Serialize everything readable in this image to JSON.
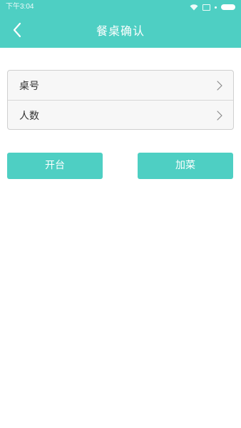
{
  "status_bar": {
    "time": "下午3:04",
    "icons": [
      "wifi-icon",
      "sim-icon",
      "dot-icon",
      "battery-icon"
    ]
  },
  "header": {
    "title": "餐桌确认",
    "back_icon": "chevron-left-icon"
  },
  "form": {
    "rows": [
      {
        "label": "桌号",
        "icon": "chevron-right-icon"
      },
      {
        "label": "人数",
        "icon": "chevron-right-icon"
      }
    ]
  },
  "actions": {
    "open_table_label": "开台",
    "add_dish_label": "加菜"
  },
  "colors": {
    "accent": "#4ecfc3",
    "text": "#333333",
    "border": "#cfcfcf",
    "card_bg": "#f7f7f7"
  }
}
